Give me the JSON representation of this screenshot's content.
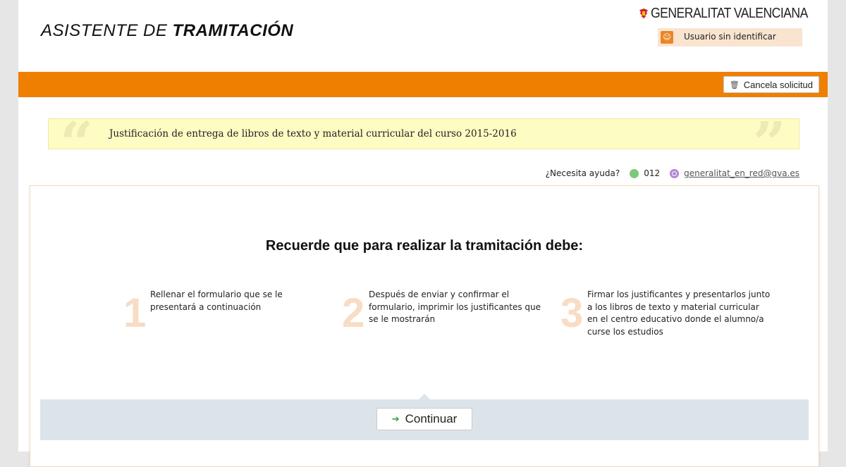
{
  "header": {
    "title_prefix": "ASISTENTE DE",
    "title_main": "TRAMITACIÓN",
    "brand": "GENERALITAT VALENCIANA",
    "user_status": "Usuario sin identificar"
  },
  "toolbar": {
    "cancel_label": "Cancela solicitud"
  },
  "procedure": {
    "title": "Justificación de entrega de libros de texto y material curricular del curso 2015-2016"
  },
  "help": {
    "label": "¿Necesita ayuda?",
    "phone": "012",
    "email": "generalitat_en_red@gva.es"
  },
  "instructions": {
    "heading": "Recuerde que para realizar la tramitación debe:",
    "steps": [
      {
        "number": "1",
        "text": "Rellenar el formulario que se le presentará a continuación"
      },
      {
        "number": "2",
        "text": "Después de enviar y confirmar el formulario, imprimir los justificantes que se le mostrarán"
      },
      {
        "number": "3",
        "text": "Firmar los justificantes y presentarlos junto a los libros de texto y material curricular en el centro educativo donde el alumno/a curse los estudios"
      }
    ]
  },
  "actions": {
    "continue_label": "Continuar"
  },
  "colors": {
    "accent": "#ee7f00",
    "quote_background": "#fdfcc3",
    "footer_band": "#dde4e9"
  },
  "icons": {
    "brand": "bat-logo-icon",
    "user": "user-badge-icon",
    "cancel": "trash-icon",
    "phone": "phone-icon",
    "email": "at-icon",
    "continue": "arrow-right-icon"
  }
}
